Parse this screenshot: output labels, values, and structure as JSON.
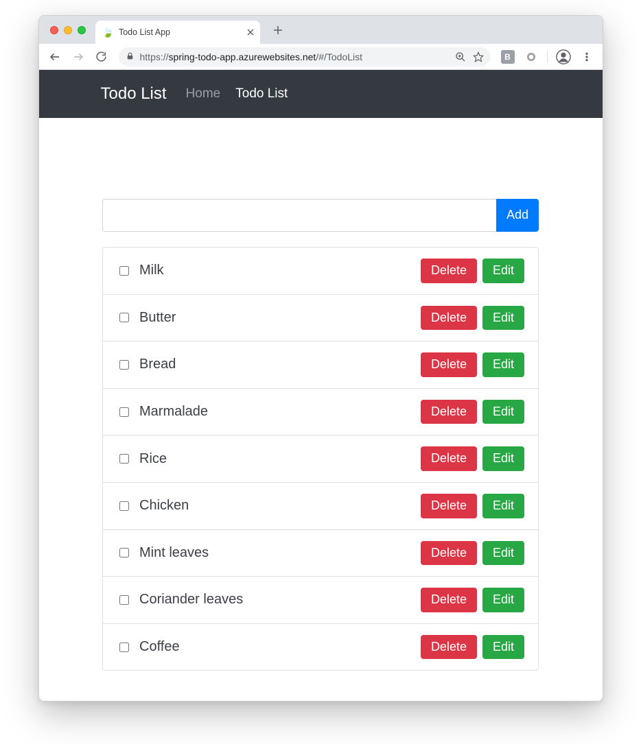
{
  "browser": {
    "tab_title": "Todo List App",
    "url_scheme": "https://",
    "url_host": "spring-todo-app.azurewebsites.net",
    "url_path": "/#/TodoList",
    "ext_letter": "B"
  },
  "navbar": {
    "brand": "Todo List",
    "links": [
      {
        "label": "Home",
        "active": false
      },
      {
        "label": "Todo List",
        "active": true
      }
    ]
  },
  "form": {
    "add_label": "Add",
    "input_value": ""
  },
  "item_actions": {
    "delete": "Delete",
    "edit": "Edit"
  },
  "items": [
    {
      "label": "Milk",
      "checked": false
    },
    {
      "label": "Butter",
      "checked": false
    },
    {
      "label": "Bread",
      "checked": false
    },
    {
      "label": "Marmalade",
      "checked": false
    },
    {
      "label": "Rice",
      "checked": false
    },
    {
      "label": "Chicken",
      "checked": false
    },
    {
      "label": "Mint leaves",
      "checked": false
    },
    {
      "label": "Coriander leaves",
      "checked": false
    },
    {
      "label": "Coffee",
      "checked": false
    }
  ]
}
